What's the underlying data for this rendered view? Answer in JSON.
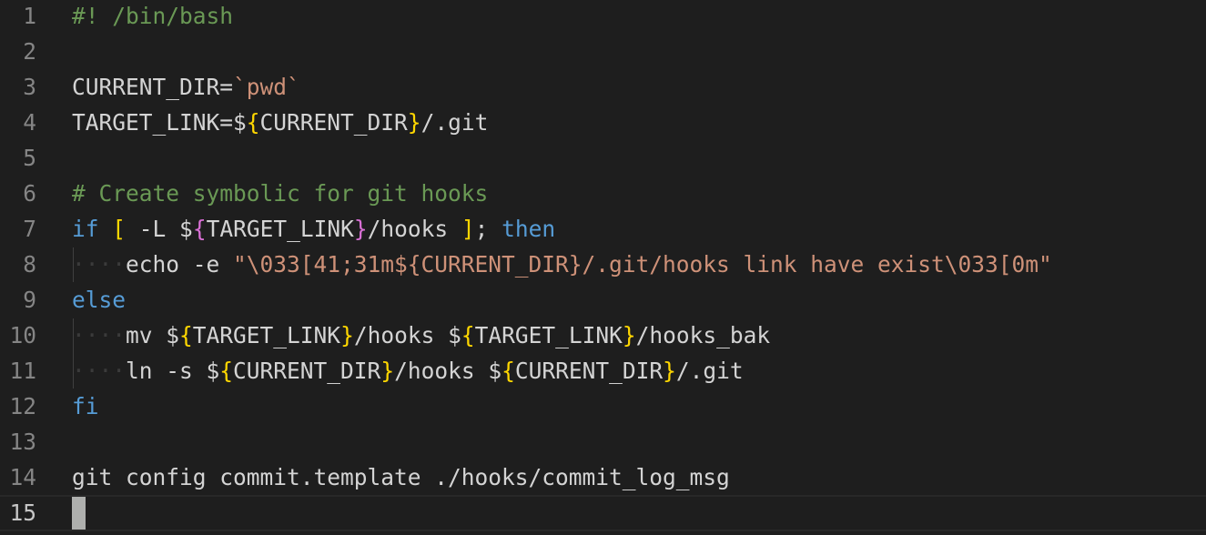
{
  "editor": {
    "language": "bash",
    "colors": {
      "background": "#1e1e1e",
      "text": "#d4d4d4",
      "comment": "#6a9955",
      "string": "#ce9178",
      "keyword": "#569cd6",
      "bracket1": "#ffd700",
      "bracket2": "#da70d6",
      "line_number": "#858585"
    },
    "current_line": 15,
    "lines": [
      {
        "num": "1",
        "tokens": [
          {
            "t": "#! /bin/bash",
            "c": "comment"
          }
        ]
      },
      {
        "num": "2",
        "tokens": []
      },
      {
        "num": "3",
        "tokens": [
          {
            "t": "CURRENT_DIR=",
            "c": "plain"
          },
          {
            "t": "`pwd`",
            "c": "string"
          }
        ]
      },
      {
        "num": "4",
        "tokens": [
          {
            "t": "TARGET_LINK=$",
            "c": "plain"
          },
          {
            "t": "{",
            "c": "br1"
          },
          {
            "t": "CURRENT_DIR",
            "c": "plain"
          },
          {
            "t": "}",
            "c": "br1"
          },
          {
            "t": "/.git",
            "c": "plain"
          }
        ]
      },
      {
        "num": "5",
        "tokens": []
      },
      {
        "num": "6",
        "tokens": [
          {
            "t": "# Create symbolic for git hooks",
            "c": "comment"
          }
        ]
      },
      {
        "num": "7",
        "tokens": [
          {
            "t": "if",
            "c": "keyword"
          },
          {
            "t": " ",
            "c": "plain"
          },
          {
            "t": "[",
            "c": "br1"
          },
          {
            "t": " -L $",
            "c": "plain"
          },
          {
            "t": "{",
            "c": "br2"
          },
          {
            "t": "TARGET_LINK",
            "c": "plain"
          },
          {
            "t": "}",
            "c": "br2"
          },
          {
            "t": "/hooks ",
            "c": "plain"
          },
          {
            "t": "]",
            "c": "br1"
          },
          {
            "t": "; ",
            "c": "plain"
          },
          {
            "t": "then",
            "c": "keyword"
          }
        ]
      },
      {
        "num": "8",
        "tokens": [
          {
            "t": "    ",
            "c": "ws"
          },
          {
            "t": "echo -e ",
            "c": "plain"
          },
          {
            "t": "\"\\033[41;31m${CURRENT_DIR}/.git/hooks link have exist\\033[0m\"",
            "c": "string"
          }
        ]
      },
      {
        "num": "9",
        "tokens": [
          {
            "t": "else",
            "c": "keyword"
          }
        ]
      },
      {
        "num": "10",
        "tokens": [
          {
            "t": "    ",
            "c": "ws"
          },
          {
            "t": "mv $",
            "c": "plain"
          },
          {
            "t": "{",
            "c": "br1"
          },
          {
            "t": "TARGET_LINK",
            "c": "plain"
          },
          {
            "t": "}",
            "c": "br1"
          },
          {
            "t": "/hooks $",
            "c": "plain"
          },
          {
            "t": "{",
            "c": "br1"
          },
          {
            "t": "TARGET_LINK",
            "c": "plain"
          },
          {
            "t": "}",
            "c": "br1"
          },
          {
            "t": "/hooks_bak",
            "c": "plain"
          }
        ]
      },
      {
        "num": "11",
        "tokens": [
          {
            "t": "    ",
            "c": "ws"
          },
          {
            "t": "ln -s $",
            "c": "plain"
          },
          {
            "t": "{",
            "c": "br1"
          },
          {
            "t": "CURRENT_DIR",
            "c": "plain"
          },
          {
            "t": "}",
            "c": "br1"
          },
          {
            "t": "/hooks $",
            "c": "plain"
          },
          {
            "t": "{",
            "c": "br1"
          },
          {
            "t": "CURRENT_DIR",
            "c": "plain"
          },
          {
            "t": "}",
            "c": "br1"
          },
          {
            "t": "/.git",
            "c": "plain"
          }
        ]
      },
      {
        "num": "12",
        "tokens": [
          {
            "t": "fi",
            "c": "keyword"
          }
        ]
      },
      {
        "num": "13",
        "tokens": []
      },
      {
        "num": "14",
        "tokens": [
          {
            "t": "git config commit.template ./hooks/commit_log_msg",
            "c": "plain"
          }
        ]
      },
      {
        "num": "15",
        "tokens": []
      }
    ]
  }
}
